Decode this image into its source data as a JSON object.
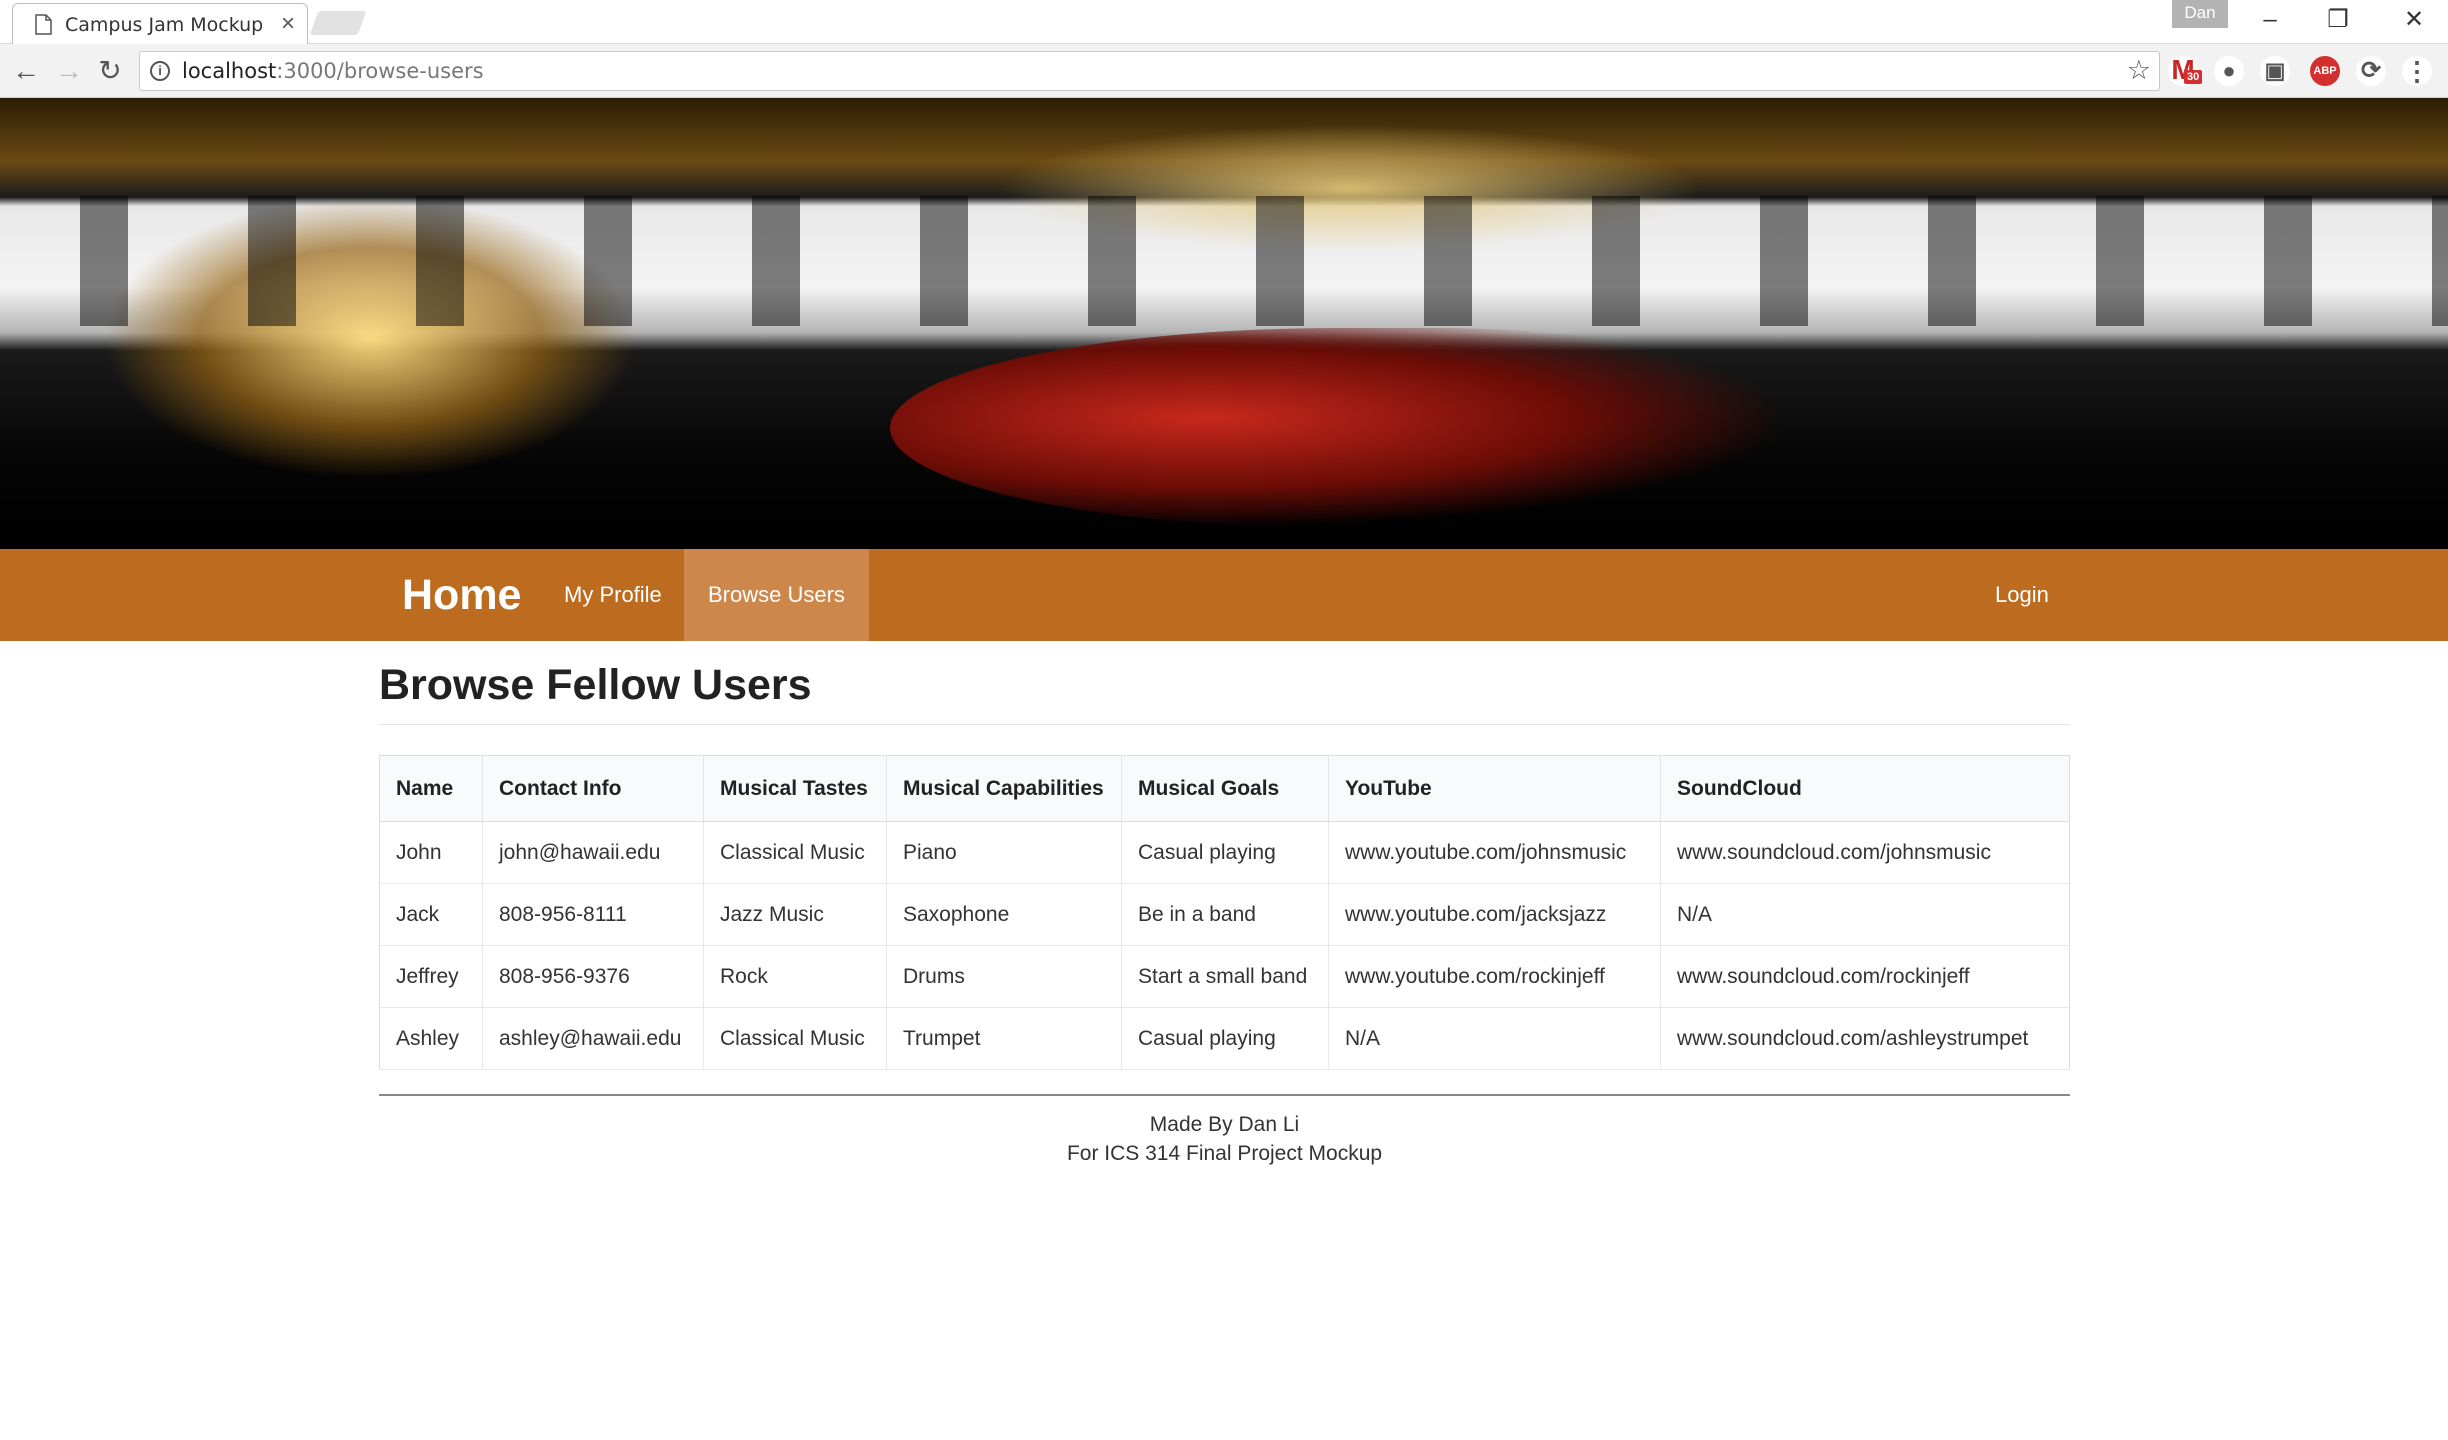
{
  "browser": {
    "tab_title": "Campus Jam Mockup",
    "tab_close": "×",
    "profile_name": "Dan",
    "url_host": "localhost",
    "url_path": ":3000/browse-users",
    "gmail_count": "30",
    "abp_label": "ABP"
  },
  "navbar": {
    "brand": "Home",
    "items": [
      "My Profile",
      "Browse Users"
    ],
    "active_item": "Browse Users",
    "login": "Login"
  },
  "page": {
    "title": "Browse Fellow Users"
  },
  "table": {
    "columns": [
      "Name",
      "Contact Info",
      "Musical Tastes",
      "Musical Capabilities",
      "Musical Goals",
      "YouTube",
      "SoundCloud"
    ],
    "rows": [
      [
        "John",
        "john@hawaii.edu",
        "Classical Music",
        "Piano",
        "Casual playing",
        "www.youtube.com/johnsmusic",
        "www.soundcloud.com/johnsmusic"
      ],
      [
        "Jack",
        "808-956-8111",
        "Jazz Music",
        "Saxophone",
        "Be in a band",
        "www.youtube.com/jacksjazz",
        "N/A"
      ],
      [
        "Jeffrey",
        "808-956-9376",
        "Rock",
        "Drums",
        "Start a small band",
        "www.youtube.com/rockinjeff",
        "www.soundcloud.com/rockinjeff"
      ],
      [
        "Ashley",
        "ashley@hawaii.edu",
        "Classical Music",
        "Trumpet",
        "Casual playing",
        "N/A",
        "www.soundcloud.com/ashleystrumpet"
      ]
    ]
  },
  "footer": {
    "line1": "Made By Dan Li",
    "line2": "For ICS 314 Final Project Mockup"
  },
  "colors": {
    "navbar": "#bd6b1e",
    "navbar_active": "#cd874a"
  }
}
